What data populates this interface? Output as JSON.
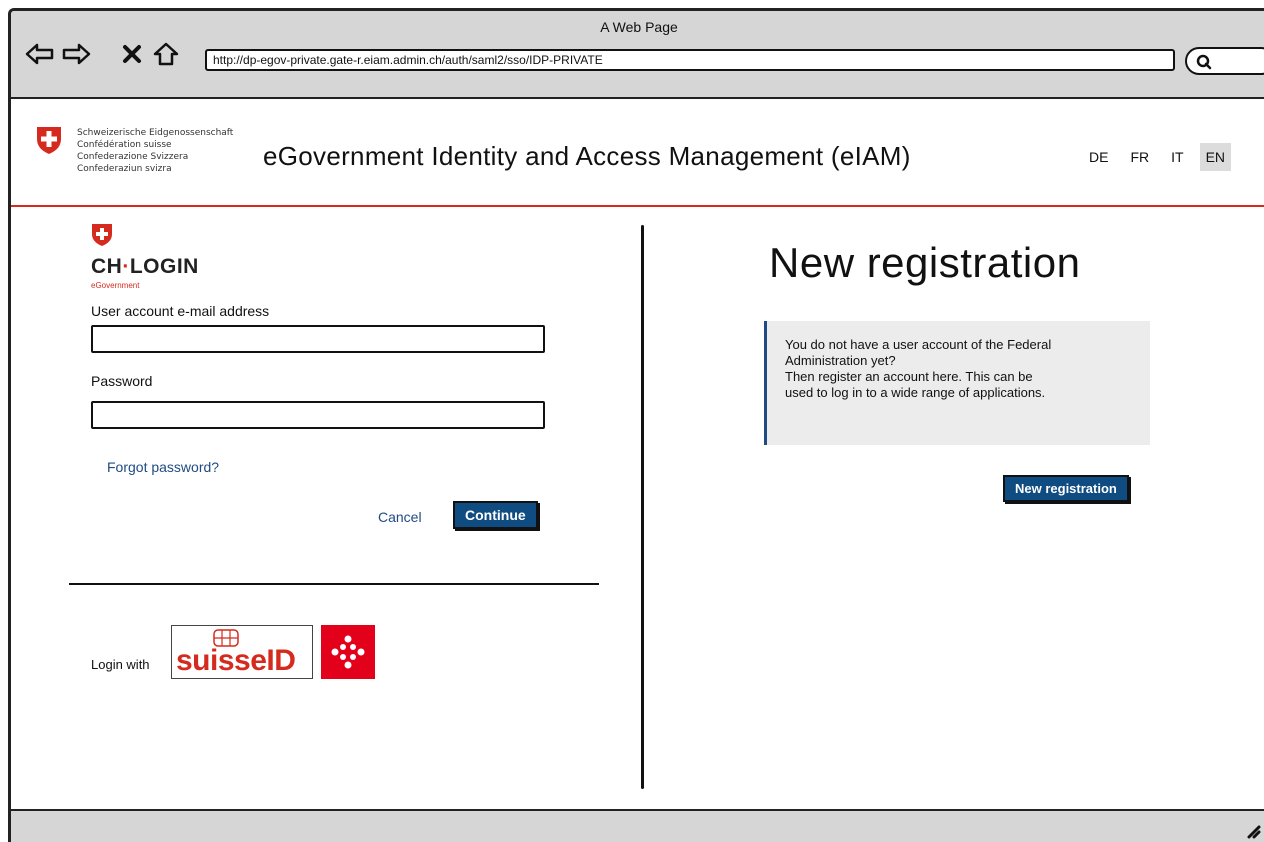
{
  "window": {
    "title": "A Web Page"
  },
  "browser": {
    "url": "http://dp-egov-private.gate-r.eiam.admin.ch/auth/saml2/sso/IDP-PRIVATE"
  },
  "header": {
    "confederation": [
      "Schweizerische Eidgenossenschaft",
      "Confédération suisse",
      "Confederazione Svizzera",
      "Confederaziun svizra"
    ],
    "title": "eGovernment Identity and Access Management (eIAM)",
    "languages": [
      "DE",
      "FR",
      "IT",
      "EN"
    ],
    "active_language": "EN"
  },
  "login": {
    "brand_left": "CH",
    "brand_dot": "·",
    "brand_right": "LOGIN",
    "brand_sub": "eGovernment",
    "email_label": "User account e-mail address",
    "email_value": "",
    "password_label": "Password",
    "password_value": "",
    "forgot_link": "Forgot password?",
    "cancel_label": "Cancel",
    "continue_label": "Continue",
    "login_with_label": "Login with",
    "suisseid_text": "suisseID"
  },
  "registration": {
    "title": "New registration",
    "info_lines": [
      "You do not have a user account of the Federal",
      "Administration yet?",
      "Then register an account here. This can be",
      "used to log in to a wide range of applications."
    ],
    "button_label": "New registration"
  },
  "colors": {
    "swiss_red": "#d52b1e",
    "primary_blue": "#0f4c81",
    "post_red": "#e3001b"
  },
  "icons": {
    "back": "arrow-left-icon",
    "forward": "arrow-right-icon",
    "stop": "close-icon",
    "home": "home-icon",
    "search": "search-icon"
  }
}
